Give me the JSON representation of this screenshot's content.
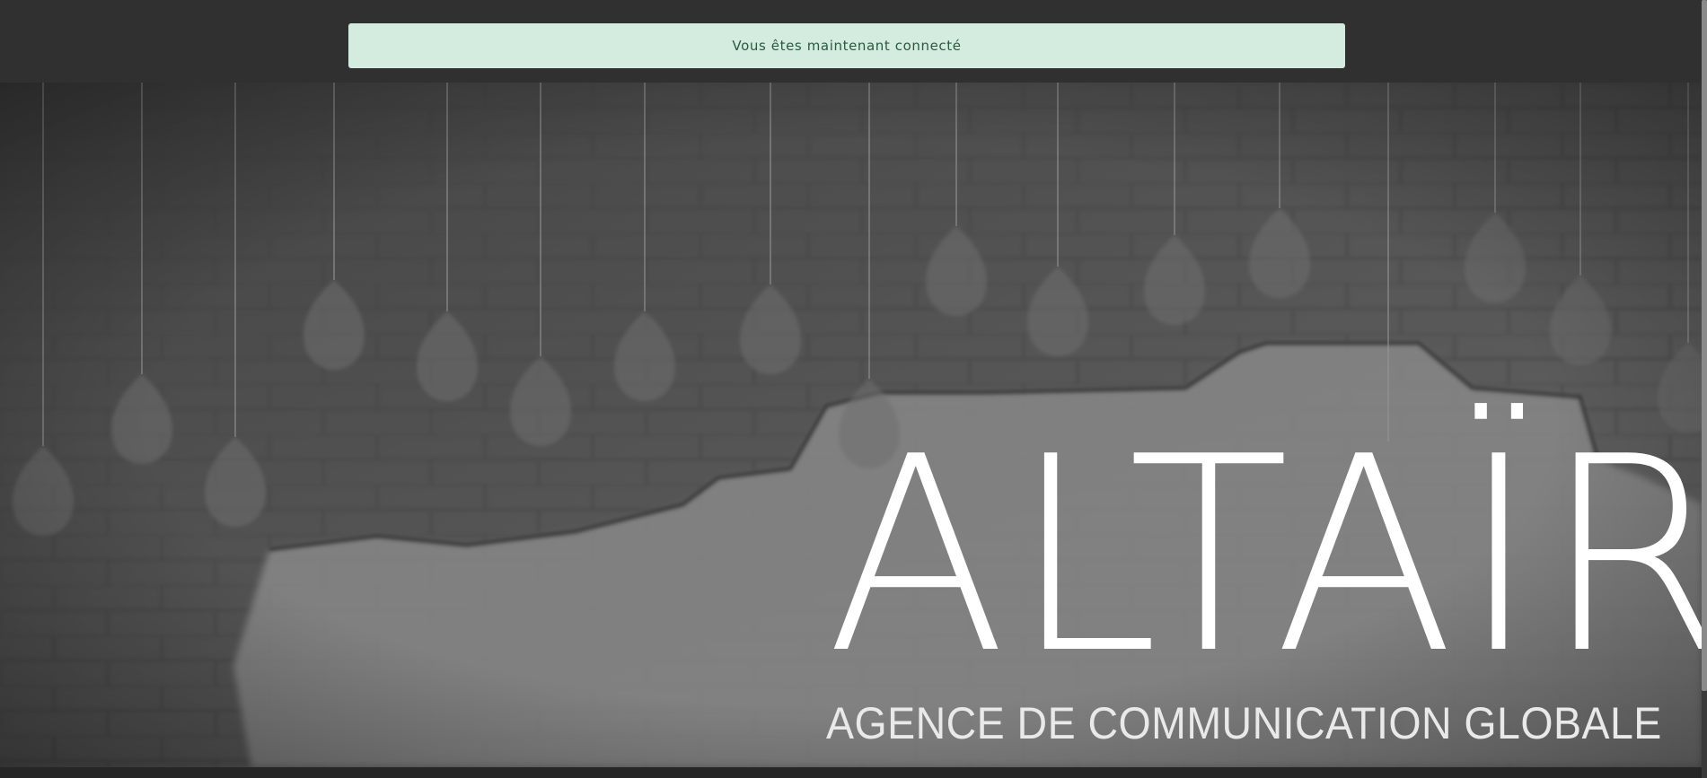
{
  "notification": {
    "message": "Vous êtes maintenant connecté"
  },
  "hero": {
    "brand_name": "ALTAÏR",
    "tagline": "AGENCE DE COMMUNICATION GLOBALE"
  },
  "colors": {
    "flash_background": "#d4ece0",
    "flash_text": "#2b5a3f",
    "top_bar": "#303030",
    "logo_text": "#ffffff"
  }
}
